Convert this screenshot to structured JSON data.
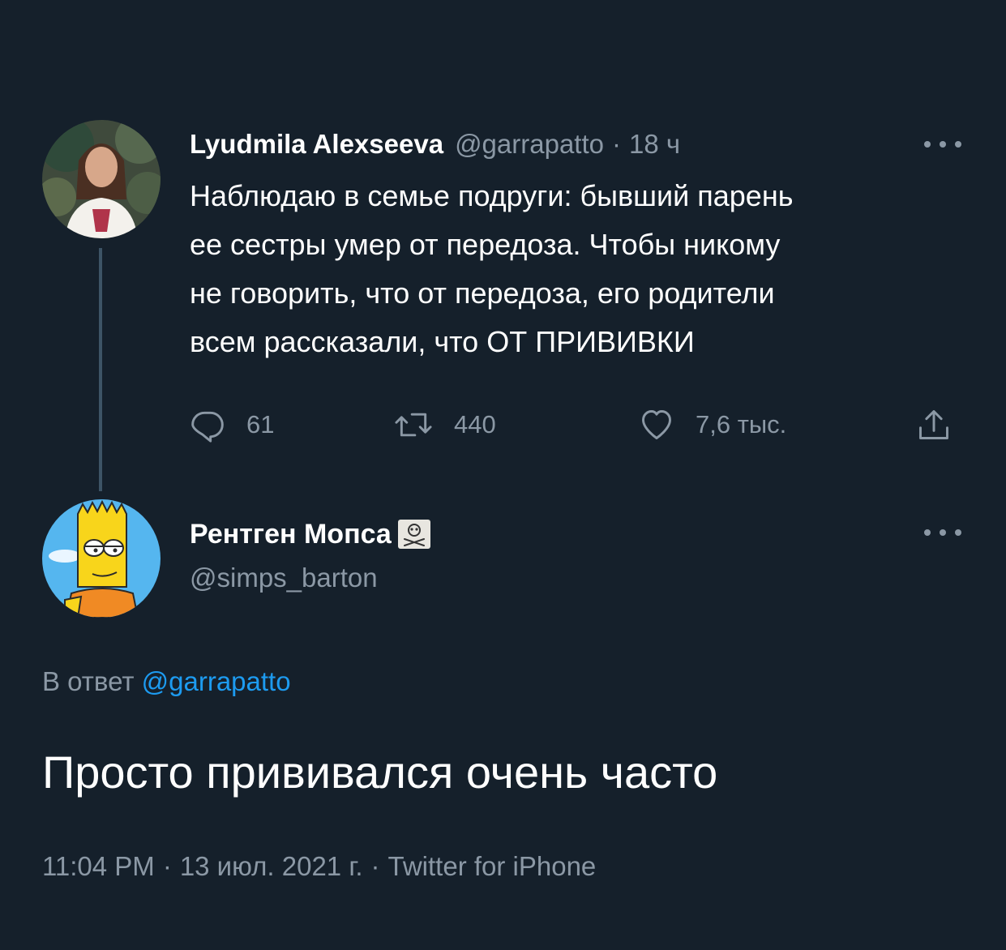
{
  "colors": {
    "background": "#15202b",
    "text_primary": "#ffffff",
    "text_secondary": "#8b98a5",
    "link": "#1d9bf0",
    "thread_line": "#3d5466"
  },
  "tweet1": {
    "avatar_icon": "user-avatar-photo",
    "author_name": "Lyudmila Alexseeva",
    "handle": "@garrapatto",
    "separator": "·",
    "time": "18 ч",
    "more_icon": "more-horizontal-icon",
    "text_lines": [
      "Наблюдаю в семье подруги: бывший парень",
      "ее сестры умер от передоза. Чтобы никому",
      "не говорить, что от передоза, его родители",
      "всем рассказали, что ОТ ПРИВИВКИ"
    ],
    "actions": {
      "reply_count": "61",
      "retweet_count": "440",
      "like_count": "7,6 тыс."
    }
  },
  "tweet2": {
    "avatar_icon": "cartoon-avatar",
    "author_name": "Рентген Мопса",
    "badge_icon": "skull-crossbones-icon",
    "handle": "@simps_barton",
    "more_icon": "more-horizontal-icon",
    "reply_to_prefix": "В ответ",
    "reply_to_handle": "@garrapatto",
    "text": "Просто прививался очень часто",
    "meta": {
      "time": "11:04 PM",
      "date": "13 июл. 2021 г.",
      "source": "Twitter for iPhone",
      "separator": "·"
    }
  }
}
